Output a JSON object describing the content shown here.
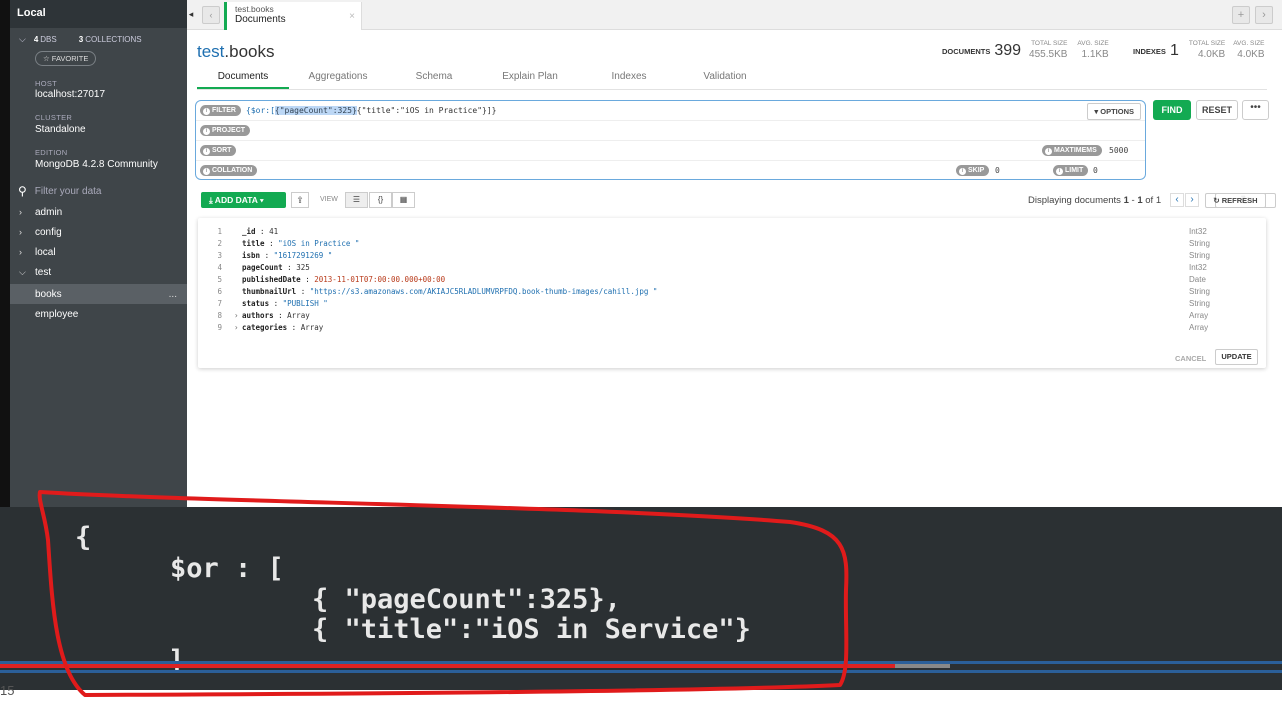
{
  "sidebar": {
    "title": "Local",
    "dbs_count": "4",
    "dbs_label": "DBS",
    "collections_count": "3",
    "collections_label": "COLLECTIONS",
    "favorite": "☆ FAVORITE",
    "host_label": "HOST",
    "host": "localhost:27017",
    "cluster_label": "CLUSTER",
    "cluster": "Standalone",
    "edition_label": "EDITION",
    "edition": "MongoDB 4.2.8 Community",
    "search_placeholder": "Filter your data",
    "databases": [
      "admin",
      "config",
      "local",
      "test"
    ],
    "collections": [
      "books",
      "employee"
    ],
    "more": "..."
  },
  "tab": {
    "line1": "test.books",
    "line2": "Documents",
    "close": "×"
  },
  "header": {
    "db": "test",
    "coll": ".books",
    "documents_label": "DOCUMENTS",
    "documents_count": "399",
    "total_size_label": "TOTAL SIZE",
    "total_size": "455.5KB",
    "avg_size_label": "AVG. SIZE",
    "avg_size": "1.1KB",
    "indexes_label": "INDEXES",
    "indexes_count": "1",
    "idx_total_size": "4.0KB",
    "idx_avg_size": "4.0KB"
  },
  "subtabs": [
    "Documents",
    "Aggregations",
    "Schema",
    "Explain Plan",
    "Indexes",
    "Validation"
  ],
  "query": {
    "filter_label": "FILTER",
    "filter_pre": "{$or:[",
    "filter_sel": "{\"pageCount\":325}",
    "filter_post": "{\"title\":\"iOS in Practice\"}]}",
    "options": "▾ OPTIONS",
    "project_label": "PROJECT",
    "sort_label": "SORT",
    "maxtimems_label": "MAXTIMEMS",
    "maxtimems": "5000",
    "collation_label": "COLLATION",
    "skip_label": "SKIP",
    "skip": "0",
    "limit_label": "LIMIT",
    "limit": "0",
    "find": "FIND",
    "reset": "RESET",
    "more": "•••"
  },
  "toolbar": {
    "add_data": "⤓ ADD DATA ▾",
    "view_label": "VIEW",
    "displaying": "Displaying documents ",
    "from": "1",
    "dash": " - ",
    "to": "1",
    "of": " of 1",
    "refresh": "↻ REFRESH"
  },
  "document": [
    {
      "n": "1",
      "key": "_id",
      "value": "41",
      "kind": "num",
      "type": "Int32"
    },
    {
      "n": "2",
      "key": "title",
      "value": "\"iOS in Practice \"",
      "kind": "str",
      "type": "String"
    },
    {
      "n": "3",
      "key": "isbn",
      "value": "\"1617291269 \"",
      "kind": "str",
      "type": "String"
    },
    {
      "n": "4",
      "key": "pageCount",
      "value": "325",
      "kind": "num",
      "type": "Int32"
    },
    {
      "n": "5",
      "key": "publishedDate",
      "value": "2013-11-01T07:00:00.000+00:00",
      "kind": "date",
      "type": "Date"
    },
    {
      "n": "6",
      "key": "thumbnailUrl",
      "value": "\"https://s3.amazonaws.com/AKIAJC5RLADLUMVRPFDQ.book-thumb-images/cahill.jpg \"",
      "kind": "str",
      "type": "String"
    },
    {
      "n": "7",
      "key": "status",
      "value": "\"PUBLISH \"",
      "kind": "str",
      "type": "String"
    },
    {
      "n": "8",
      "key": "authors",
      "value": "Array",
      "kind": "num",
      "type": "Array",
      "expandable": true
    },
    {
      "n": "9",
      "key": "categories",
      "value": "Array",
      "kind": "num",
      "type": "Array",
      "expandable": true
    }
  ],
  "doc_actions": {
    "cancel": "CANCEL",
    "update": "UPDATE"
  },
  "overlay_code": [
    "{",
    "$or : [",
    "{ \"pageCount\":325},",
    "{ \"title\":\"iOS in Service\"}",
    "]"
  ],
  "bottom_number": "15",
  "colors": {
    "green": "#13aa52",
    "blue": "#1e6fb0",
    "annotation_red": "#e01b1b"
  }
}
